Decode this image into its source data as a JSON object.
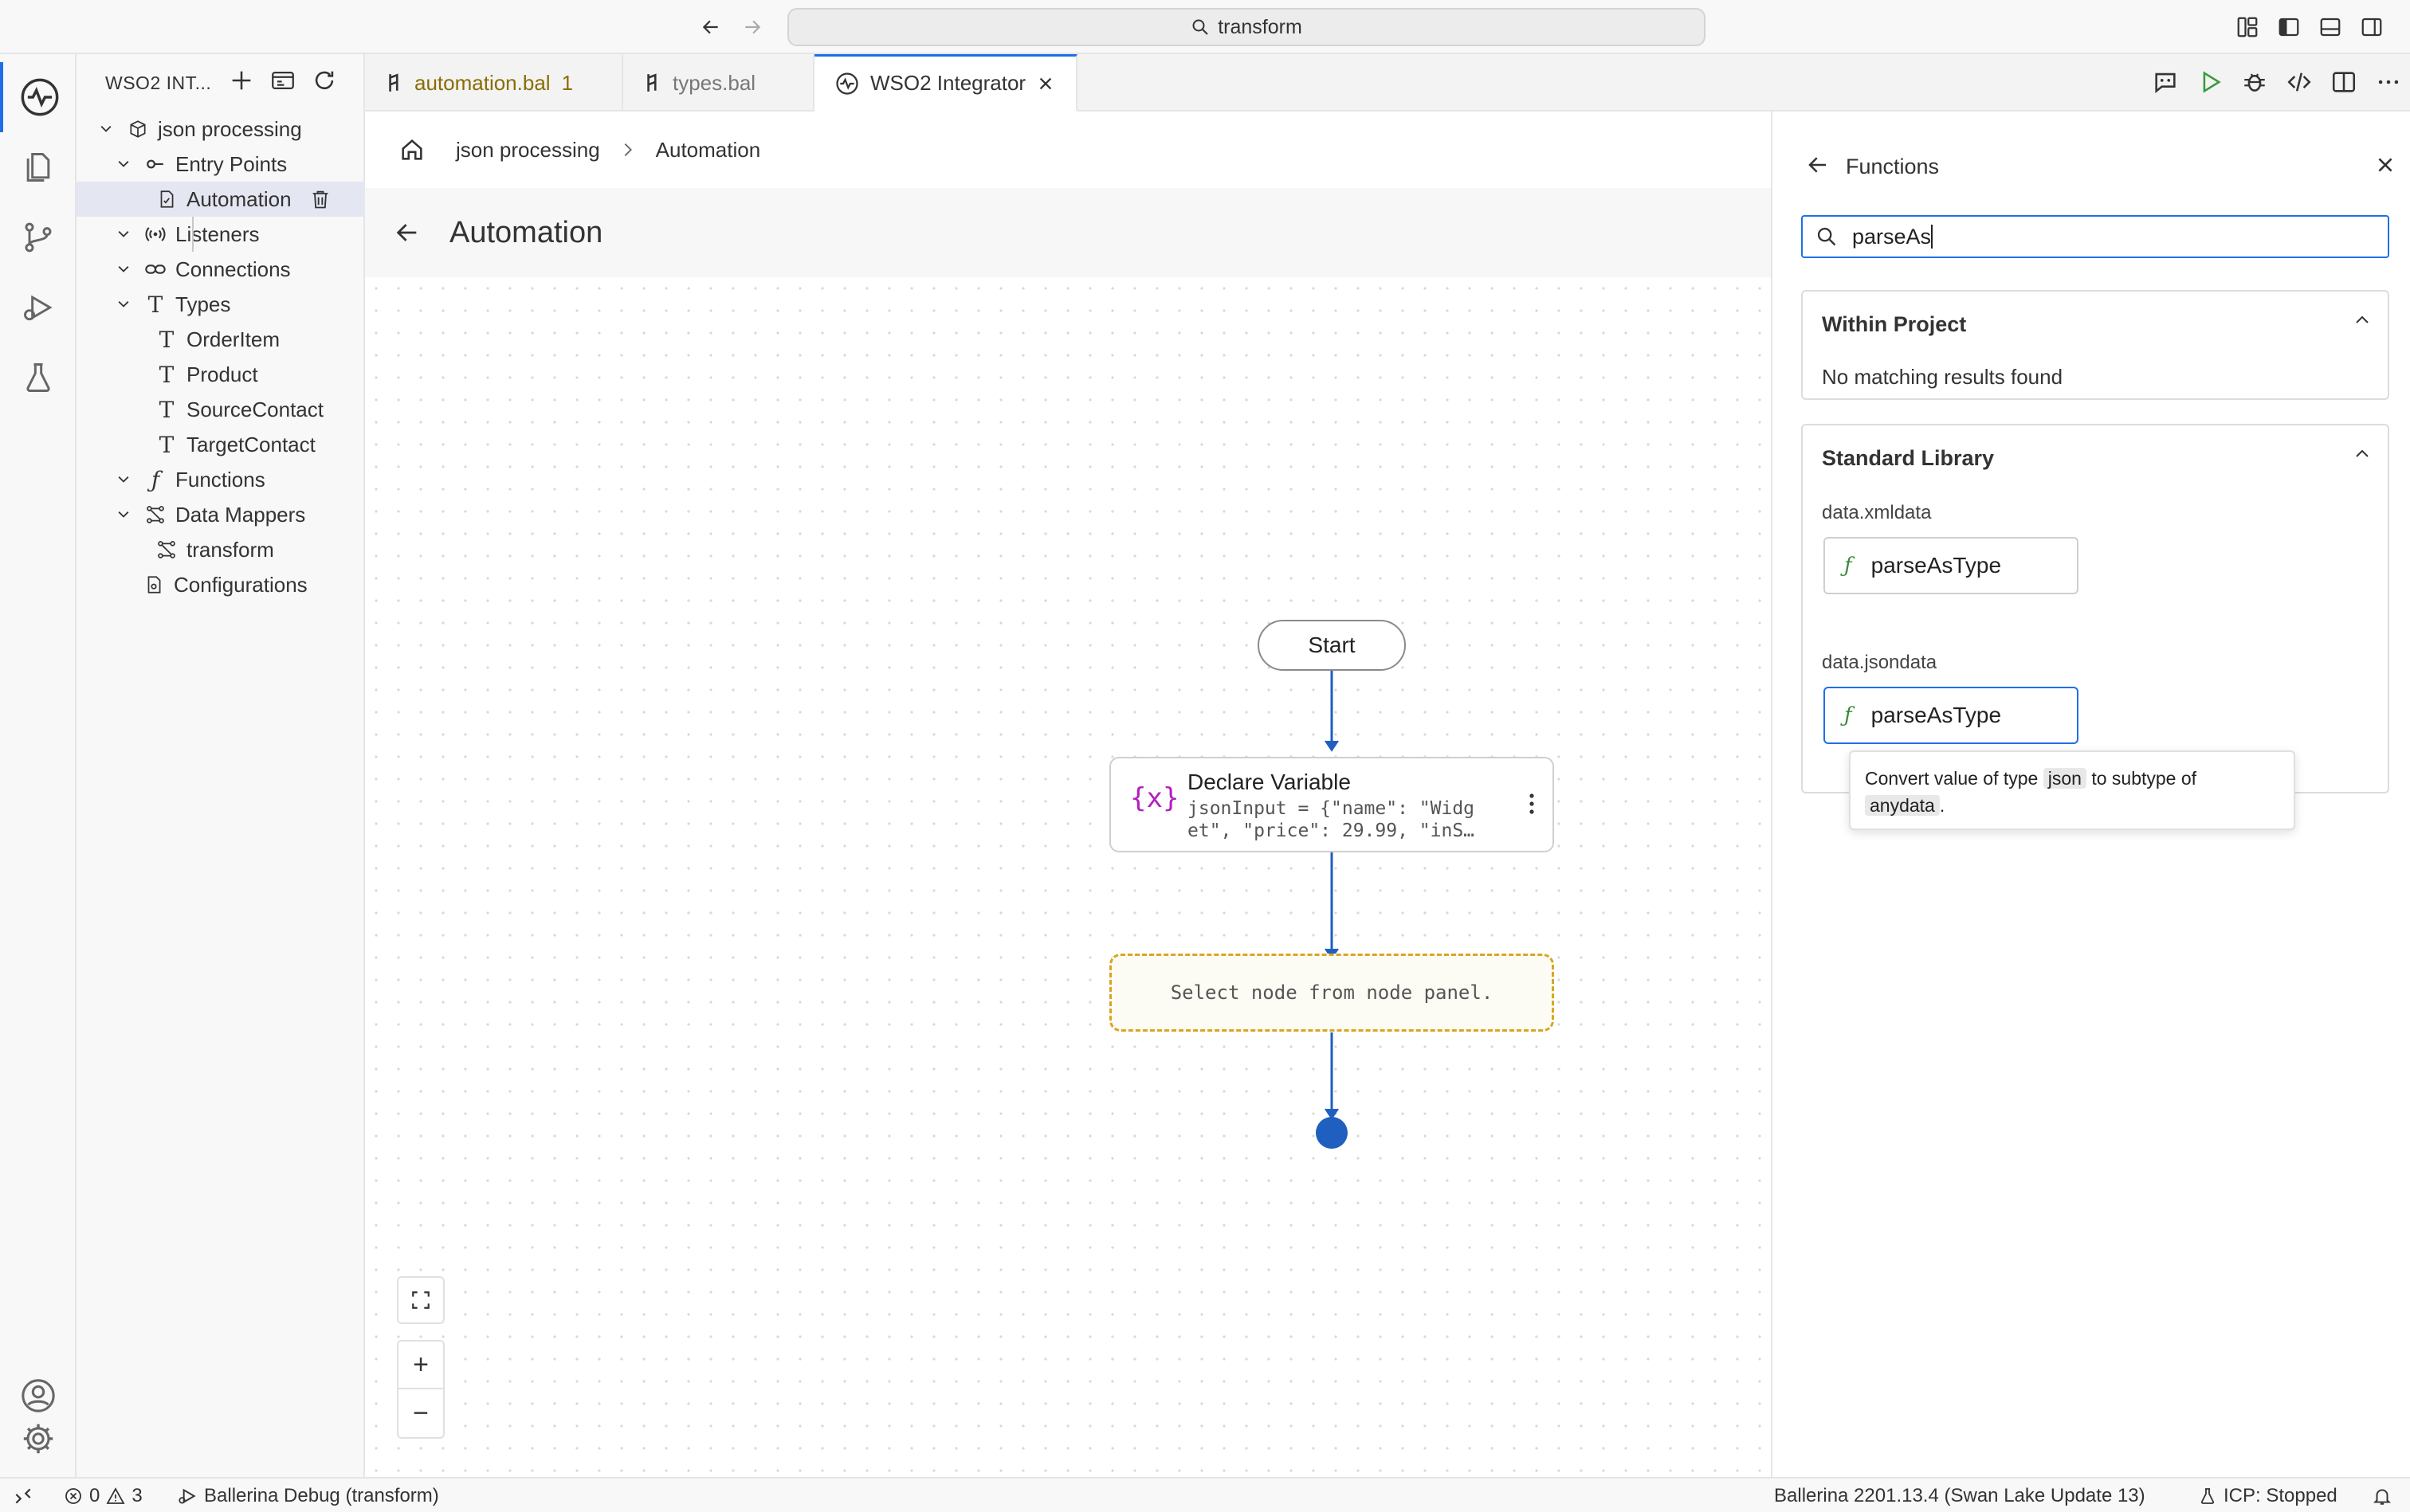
{
  "titlebar": {
    "search_text": "transform"
  },
  "sidebar": {
    "title": "WSO2 INT...",
    "tree": {
      "project": "json processing",
      "entry_points": "Entry Points",
      "automation": "Automation",
      "listeners": "Listeners",
      "connections": "Connections",
      "types": "Types",
      "type_items": [
        "OrderItem",
        "Product",
        "SourceContact",
        "TargetContact"
      ],
      "functions": "Functions",
      "data_mappers": "Data Mappers",
      "transform": "transform",
      "configurations": "Configurations"
    }
  },
  "tabs": [
    {
      "label": "automation.bal",
      "badge": "1"
    },
    {
      "label": "types.bal"
    },
    {
      "label": "WSO2 Integrator"
    }
  ],
  "breadcrumb": {
    "project": "json processing",
    "current": "Automation"
  },
  "view": {
    "title": "Automation"
  },
  "flow": {
    "start_label": "Start",
    "declare": {
      "icon": "{x}",
      "title": "Declare Variable",
      "line1": "jsonInput = {\"name\": \"Widg",
      "line2": "et\", \"price\": 29.99, \"inS…"
    },
    "placeholder": "Select node from node panel."
  },
  "zoom": {
    "in": "+",
    "out": "−"
  },
  "functions_panel": {
    "title": "Functions",
    "search_value": "parseAs",
    "within_project": {
      "title": "Within Project",
      "empty": "No matching results found"
    },
    "standard_library": {
      "title": "Standard Library",
      "groups": [
        {
          "module": "data.xmldata",
          "function": "parseAsType"
        },
        {
          "module": "data.jsondata",
          "function": "parseAsType"
        }
      ]
    },
    "tooltip": {
      "prefix": "Convert value of type",
      "type1": "json",
      "middle": "to subtype of",
      "type2": "anydata",
      "suffix": "."
    }
  },
  "statusbar": {
    "errors": "0",
    "warnings": "3",
    "debug": "Ballerina Debug (transform)",
    "version": "Ballerina 2201.13.4 (Swan Lake Update 13)",
    "icp": "ICP: Stopped"
  },
  "colors": {
    "accent": "#1f6feb",
    "flow_line": "#1f5fbf",
    "placeholder_border": "#d9a521",
    "variable_icon": "#b21fbf",
    "function_icon": "#3a8a3a"
  }
}
